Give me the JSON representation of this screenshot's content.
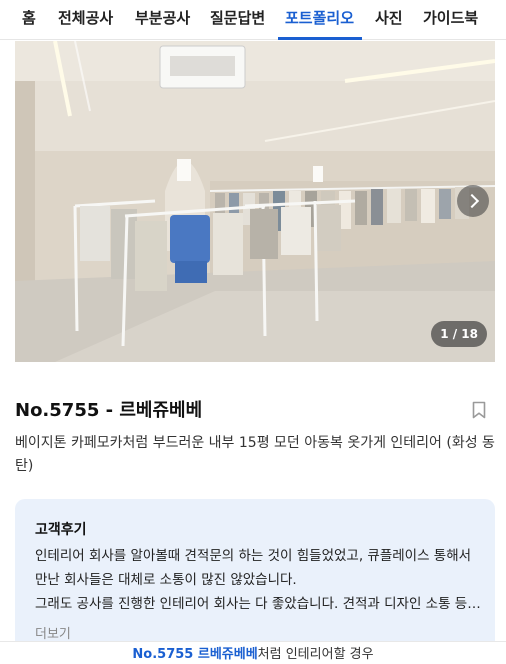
{
  "nav": {
    "tabs": [
      {
        "label": "홈"
      },
      {
        "label": "전체공사"
      },
      {
        "label": "부분공사"
      },
      {
        "label": "질문답변"
      },
      {
        "label": "포트폴리오",
        "active": true
      },
      {
        "label": "사진"
      },
      {
        "label": "가이드북"
      }
    ]
  },
  "gallery": {
    "counter": "1 / 18",
    "next_icon": "chevron-right-icon"
  },
  "portfolio": {
    "title": "No.5755 - 르베쥬베베",
    "description": "베이지톤 카페모카처럼 부드러운 내부 15평 모던 아동복 옷가게 인테리어 (화성 동탄)",
    "bookmark_icon": "bookmark-icon"
  },
  "review": {
    "heading": "고객후기",
    "line1": "인테리어 회사를 알아볼때 견적문의 하는 것이 힘들었었고, 큐플레이스 통해서 만난 회사들은 대체로 소통이 많진 않았습니다.",
    "line2": "그래도 공사를 진행한 인테리어 회사는 다 좋았습니다. 견적과 디자인 소통 등 모든 과정이 만족스러웠습니다.",
    "more": "더보기"
  },
  "bottom_bar": {
    "highlight": "No.5755 르베쥬베베",
    "suffix": "처럼 인테리어할 경우"
  },
  "colors": {
    "accent": "#1a5fd1",
    "review_bg": "#eaf1fb"
  }
}
